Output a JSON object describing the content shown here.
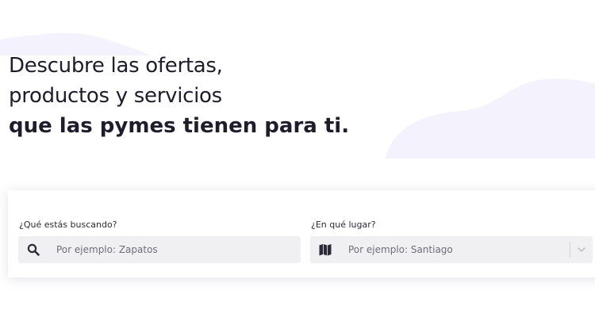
{
  "hero": {
    "line1": "Descubre las ofertas,",
    "line2": "productos y servicios",
    "line3": "que las pymes tienen para ti."
  },
  "search": {
    "what_label": "¿Qué estás buscando?",
    "what_placeholder": "Por ejemplo: Zapatos",
    "what_icon": "search-icon",
    "where_label": "¿En qué lugar?",
    "where_placeholder": "Por ejemplo: Santiago",
    "where_icon": "map-icon",
    "where_dropdown_icon": "chevron-down-icon"
  },
  "colors": {
    "text": "#1f1d2b",
    "input_bg": "#f0f0f3",
    "blob": "#f3f2fd",
    "placeholder": "#6f6e78"
  }
}
